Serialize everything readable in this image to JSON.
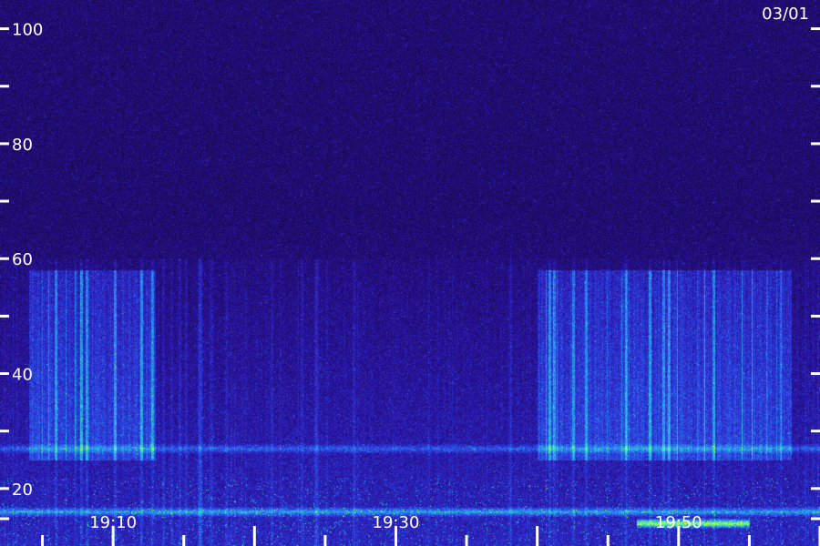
{
  "chart_data": {
    "type": "heatmap",
    "title": "",
    "date_label": "03/01",
    "xlabel": "",
    "ylabel": "",
    "x_ticks": [
      {
        "value": "19:10",
        "label": "19:10"
      },
      {
        "value": "19:30",
        "label": "19:30"
      },
      {
        "value": "19:50",
        "label": "19:50"
      }
    ],
    "xlim": [
      "19:02",
      "20:00"
    ],
    "ylim": [
      10,
      105
    ],
    "y_ticks": [
      {
        "value": 100,
        "label": "100"
      },
      {
        "value": 80,
        "label": "80"
      },
      {
        "value": 60,
        "label": "60"
      },
      {
        "value": 40,
        "label": "40"
      },
      {
        "value": 20,
        "label": "20"
      }
    ],
    "colormap": [
      "#1a0a55",
      "#2a12a0",
      "#2c3ee0",
      "#2a8cf0",
      "#30e0d0",
      "#a8ff40"
    ],
    "features": [
      {
        "kind": "horizontal-band",
        "y": 27,
        "intensity": "medium",
        "from": "19:02",
        "to": "20:00"
      },
      {
        "kind": "horizontal-band",
        "y": 16,
        "intensity": "high",
        "from": "19:02",
        "to": "20:00"
      },
      {
        "kind": "horizontal-band",
        "y": 14,
        "intensity": "very-high",
        "from": "19:47",
        "to": "19:55"
      },
      {
        "kind": "broadband-region",
        "y_range": [
          25,
          58
        ],
        "from": "19:04",
        "to": "19:13"
      },
      {
        "kind": "broadband-region",
        "y_range": [
          25,
          58
        ],
        "from": "19:40",
        "to": "19:58"
      }
    ]
  }
}
